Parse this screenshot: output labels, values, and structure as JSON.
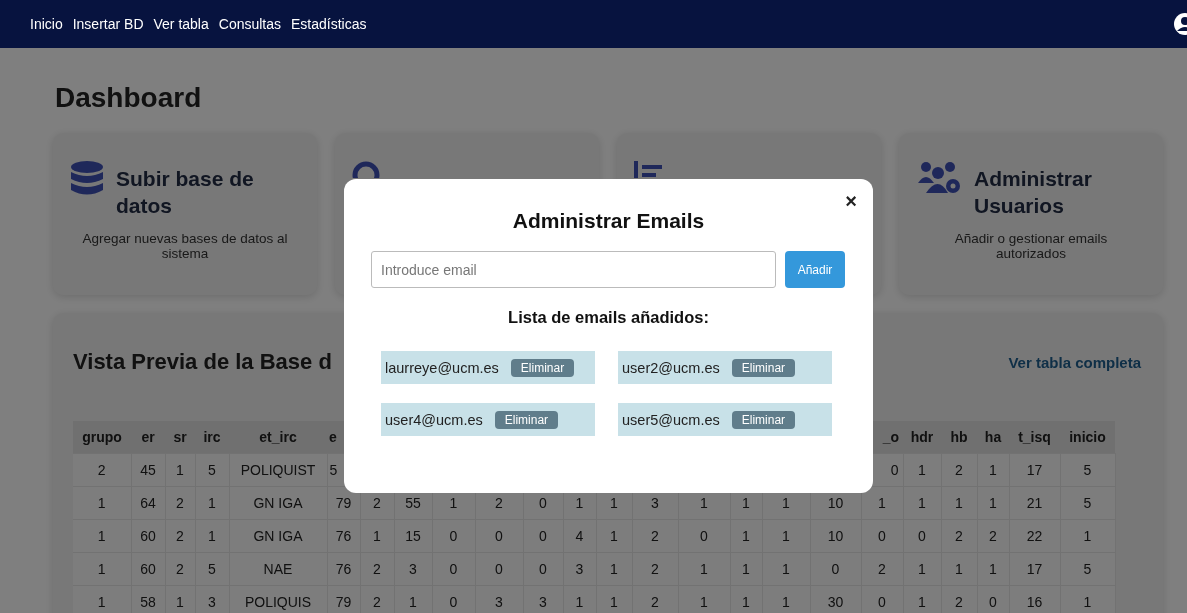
{
  "nav": {
    "links": [
      "Inicio",
      "Insertar BD",
      "Ver tabla",
      "Consultas",
      "Estadísticas"
    ]
  },
  "page_title": "Dashboard",
  "cards": [
    {
      "kind": "database",
      "title": "Subir base de datos",
      "description": "Agregar nuevas bases de datos al sistema"
    },
    {
      "kind": "search"
    },
    {
      "kind": "list"
    },
    {
      "kind": "users",
      "title": "Administrar Usuarios",
      "description": "Añadir o gestionar emails autorizados"
    }
  ],
  "preview": {
    "title": "Vista Previa de la Base d",
    "link": "Ver tabla completa",
    "columns": [
      "grupo",
      "er",
      "sr",
      "irc",
      "et_irc",
      "e",
      null,
      null,
      null,
      null,
      null,
      null,
      null,
      null,
      null,
      null,
      null,
      null,
      "_o",
      "hdr",
      "hb",
      "ha",
      "t_isq",
      "inicio"
    ],
    "rows": [
      [
        "2",
        "45",
        "1",
        "5",
        "POLIQUIST",
        "5",
        null,
        null,
        null,
        null,
        null,
        null,
        null,
        null,
        null,
        null,
        null,
        null,
        "0",
        "1",
        "2",
        "1",
        "17",
        "5"
      ],
      [
        "1",
        "64",
        "2",
        "1",
        "GN IGA",
        "79",
        "2",
        "55",
        "1",
        "2",
        "0",
        "1",
        "1",
        "3",
        "1",
        "1",
        "1",
        "10",
        "1",
        "1",
        "1",
        "1",
        "21",
        "5"
      ],
      [
        "1",
        "60",
        "2",
        "1",
        "GN IGA",
        "76",
        "1",
        "15",
        "0",
        "0",
        "0",
        "4",
        "1",
        "2",
        "0",
        "1",
        "1",
        "10",
        "0",
        "0",
        "2",
        "2",
        "22",
        "1"
      ],
      [
        "1",
        "60",
        "2",
        "5",
        "NAE",
        "76",
        "2",
        "3",
        "0",
        "0",
        "0",
        "3",
        "1",
        "2",
        "1",
        "1",
        "1",
        "0",
        "2",
        "1",
        "1",
        "1",
        "17",
        "5"
      ],
      [
        "1",
        "58",
        "1",
        "3",
        "POLIQUIS",
        "79",
        "2",
        "1",
        "0",
        "3",
        "3",
        "1",
        "1",
        "2",
        "1",
        "1",
        "1",
        "30",
        "0",
        "1",
        "2",
        "0",
        "16",
        "1"
      ]
    ]
  },
  "modal": {
    "title": "Administrar Emails",
    "close": "×",
    "input": {
      "placeholder": "Introduce email"
    },
    "add_button": "Añadir",
    "list_title": "Lista de emails añadidos:",
    "emails": [
      {
        "email": "laurreye@ucm.es",
        "button": "Eliminar"
      },
      {
        "email": "user2@ucm.es",
        "button": "Eliminar"
      },
      {
        "email": "user4@ucm.es",
        "button": "Eliminar"
      },
      {
        "email": "user5@ucm.es",
        "button": "Eliminar"
      }
    ]
  }
}
